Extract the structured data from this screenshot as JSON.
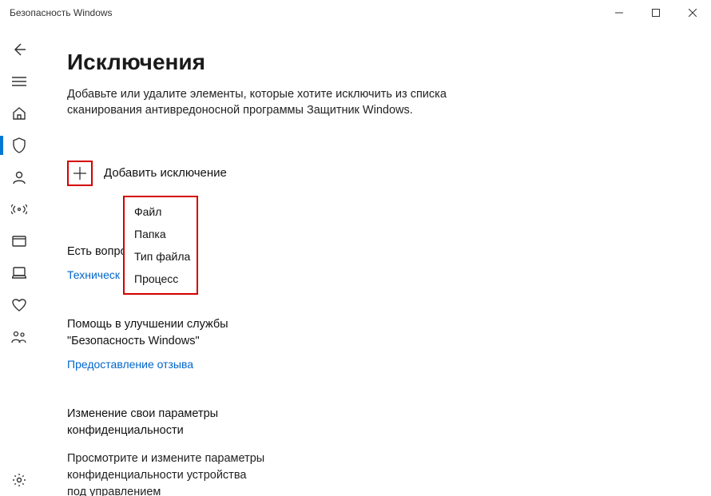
{
  "window": {
    "title": "Безопасность Windows"
  },
  "page": {
    "heading": "Исключения",
    "description": "Добавьте или удалите элементы, которые хотите исключить из списка сканирования антивредоносной программы Защитник Windows."
  },
  "add": {
    "label": "Добавить исключение",
    "options": [
      "Файл",
      "Папка",
      "Тип файла",
      "Процесс"
    ]
  },
  "questions": {
    "title": "Есть вопро",
    "link": "Техническ"
  },
  "feedback": {
    "title": "Помощь в улучшении службы \"Безопасность Windows\"",
    "link": "Предоставление отзыва"
  },
  "privacy": {
    "title": "Изменение свои параметры конфиденциальности",
    "desc": "Просмотрите и измените параметры конфиденциальности устройства под управлением"
  }
}
